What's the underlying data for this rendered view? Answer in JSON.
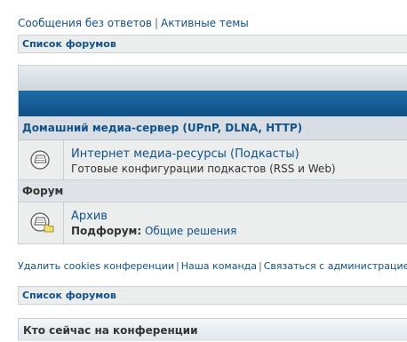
{
  "top_links": {
    "unanswered": "Сообщения без ответов",
    "separator": "|",
    "active": "Активные темы"
  },
  "breadcrumb_top": {
    "label": "Список форумов"
  },
  "category": {
    "title": "Домашний медиа-сервер (UPnP, DLNA, HTTP)",
    "forums": [
      {
        "title": "Интернет медиа-ресурсы (Подкасты)",
        "description": "Готовые конфигурации подкастов (RSS и Web)",
        "icon": "forum-read-icon"
      }
    ]
  },
  "forum_section": {
    "header": "Форум",
    "forums": [
      {
        "title": "Архив",
        "subforum_label": "Подфорум:",
        "subforum_link": "Общие решения",
        "icon": "forum-subforum-icon"
      }
    ]
  },
  "footer_links": {
    "delete_cookies": "Удалить cookies конференции",
    "team": "Наша команда",
    "contact": "Связаться с администрацией",
    "separator": "|"
  },
  "breadcrumb_bottom": {
    "label": "Список форумов"
  },
  "who_is_online": {
    "title": "Кто сейчас на конференции"
  },
  "colors": {
    "link": "#105289",
    "blue_band": "#0f5187",
    "row_bg": "#eceded"
  }
}
